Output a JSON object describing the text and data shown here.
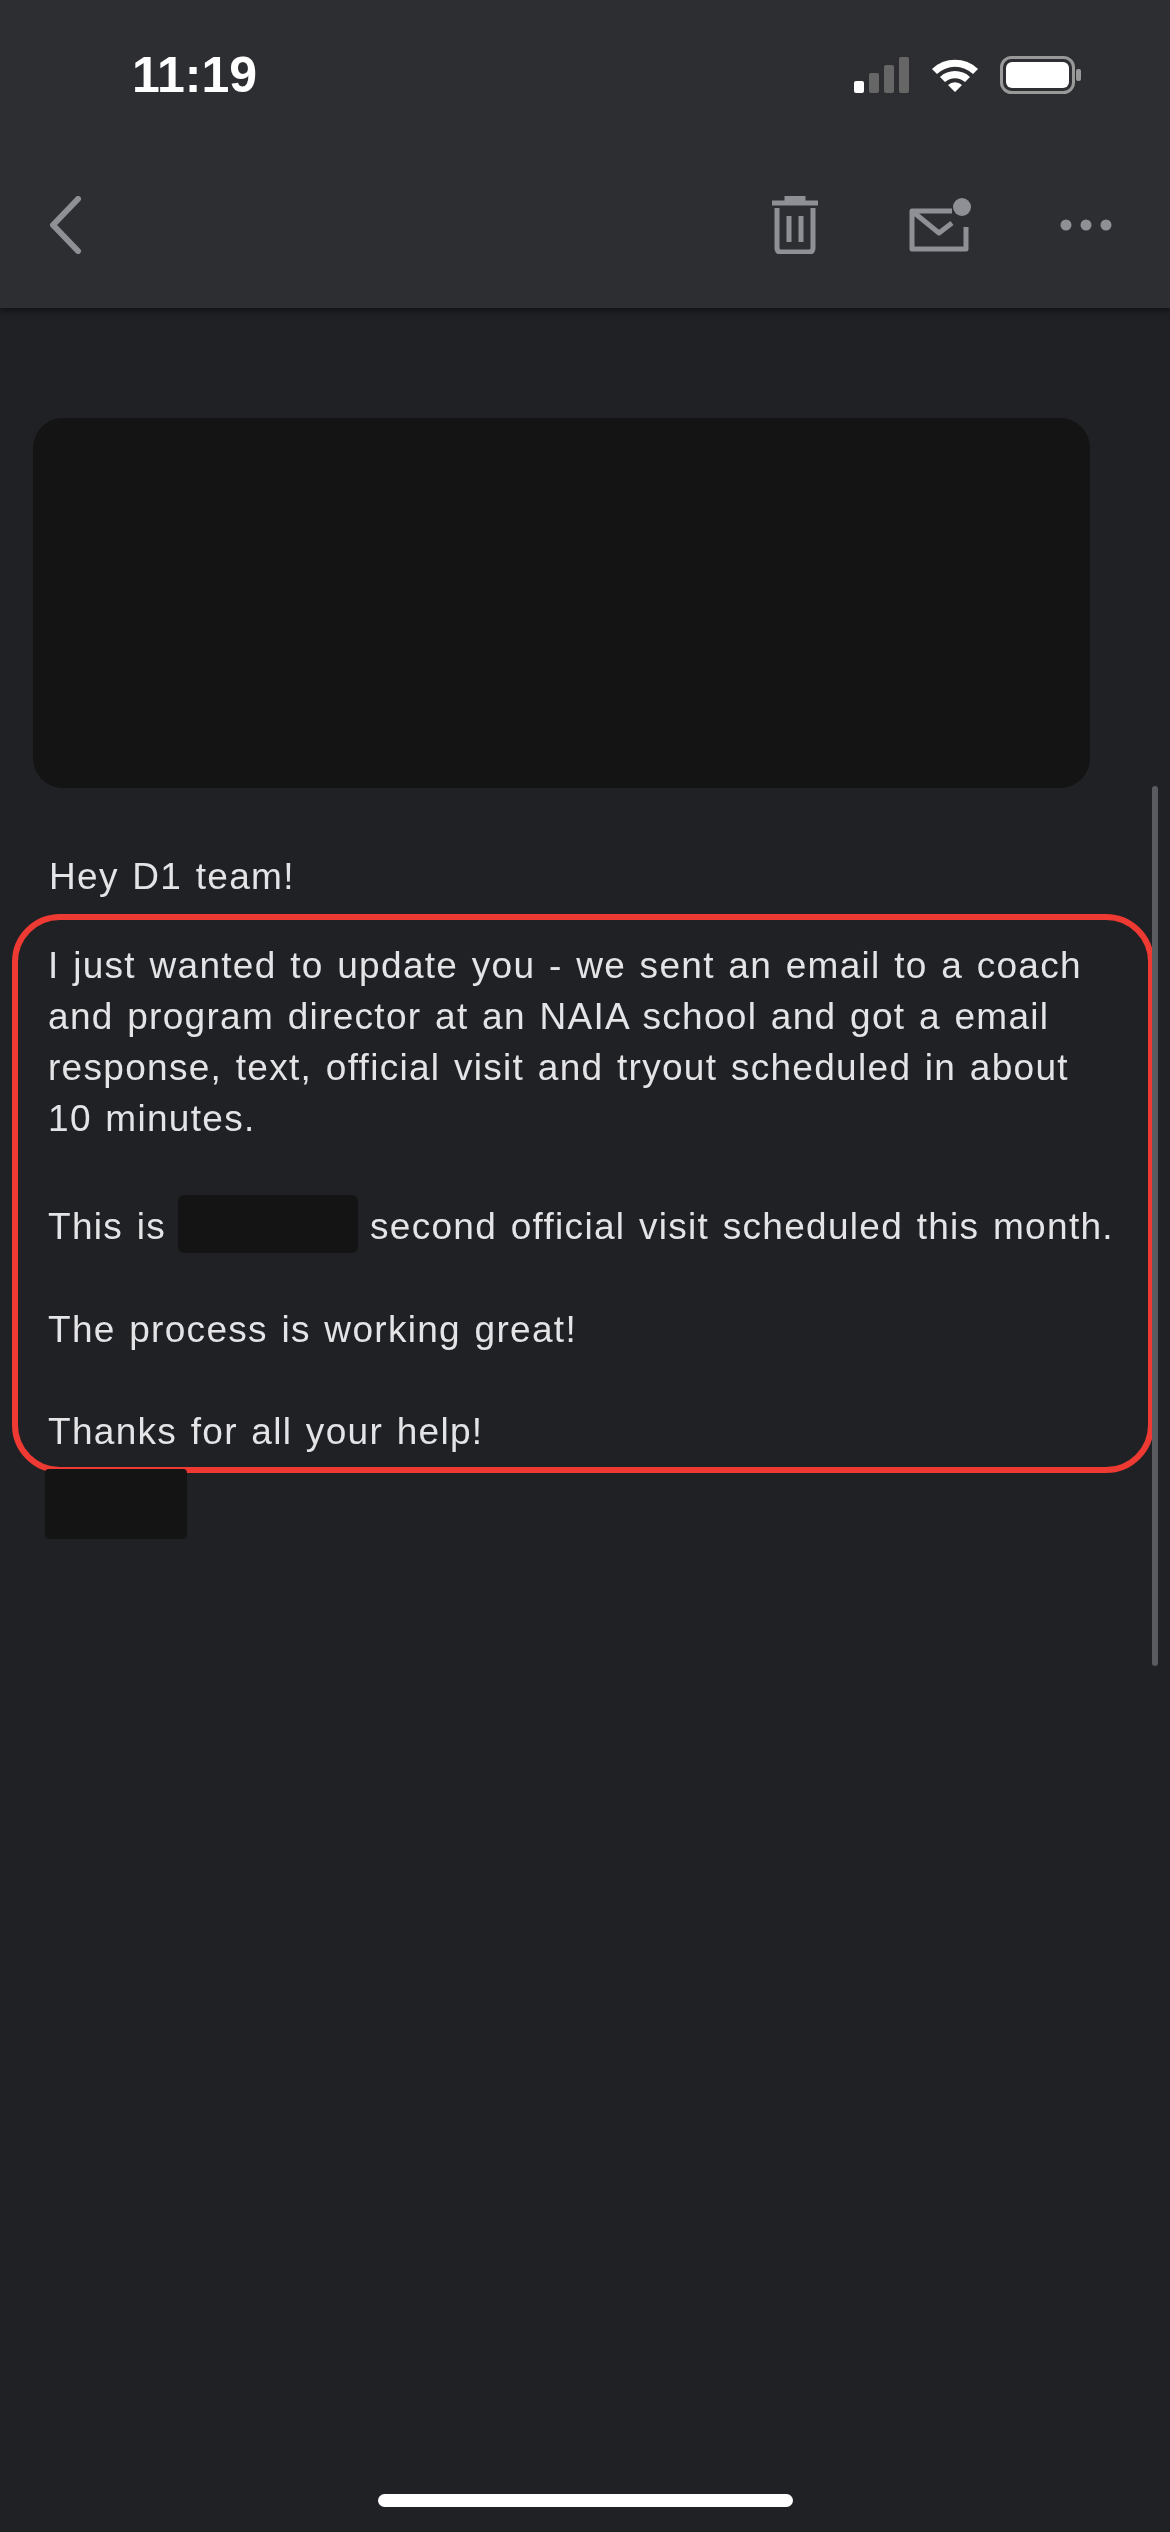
{
  "status_bar": {
    "time": "11:19"
  },
  "message": {
    "greeting": "Hey D1 team!",
    "highlight": {
      "paragraphs": [
        {
          "parts": [
            "I just wanted to update you - we sent an email to a coach and program director at an NAIA school and got a email response, text, official visit and tryout scheduled in about 10 minutes."
          ]
        },
        {
          "parts": [
            "This is",
            "second official visit scheduled this month."
          ]
        },
        {
          "parts": [
            "The process is working great!"
          ]
        },
        {
          "parts": [
            "Thanks for all your help!"
          ]
        }
      ]
    }
  }
}
